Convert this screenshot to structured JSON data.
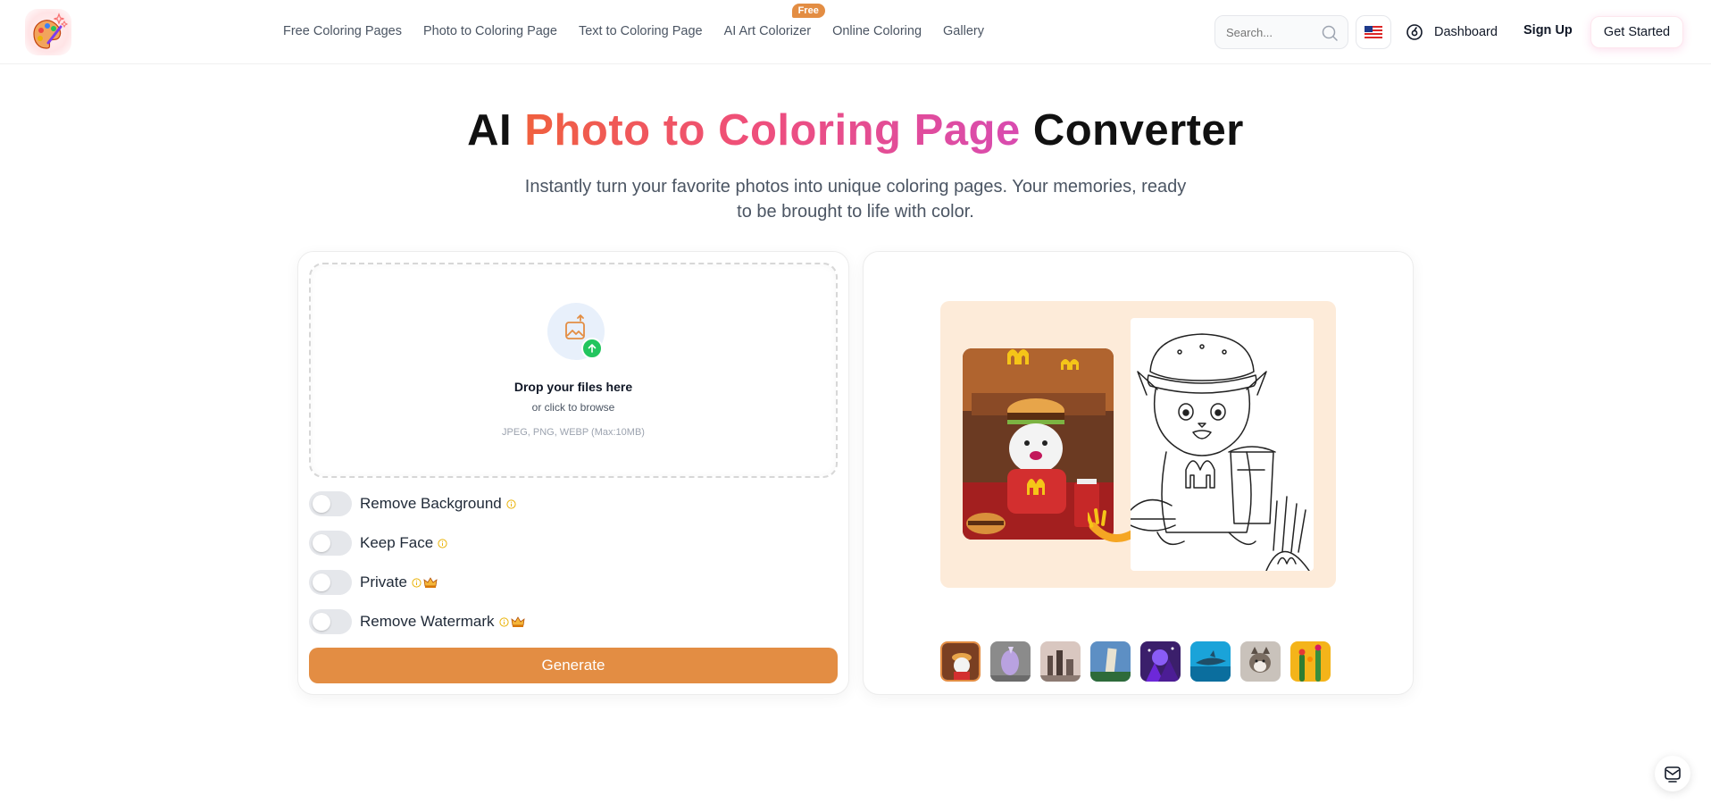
{
  "nav": {
    "items": [
      {
        "label": "Free Coloring Pages"
      },
      {
        "label": "Photo to Coloring Page"
      },
      {
        "label": "Text to Coloring Page"
      },
      {
        "label": "AI Art Colorizer",
        "badge": "Free"
      },
      {
        "label": "Online Coloring"
      },
      {
        "label": "Gallery"
      }
    ],
    "search_placeholder": "Search...",
    "dashboard": "Dashboard",
    "sign_up": "Sign Up",
    "get_started": "Get Started"
  },
  "hero": {
    "title_prefix": "AI",
    "title_highlight": "Photo to Coloring Page",
    "title_suffix": "Converter",
    "subtitle": "Instantly turn your favorite photos into unique coloring pages. Your memories, ready to be brought to life with color."
  },
  "upload": {
    "title": "Drop your files here",
    "subtitle": "or click to browse",
    "formats": "JPEG, PNG, WEBP (Max:10MB)"
  },
  "options": [
    {
      "label": "Remove Background",
      "enabled": false,
      "premium": false
    },
    {
      "label": "Keep Face",
      "enabled": false,
      "premium": false
    },
    {
      "label": "Private",
      "enabled": false,
      "premium": true
    },
    {
      "label": "Remove Watermark",
      "enabled": false,
      "premium": true
    }
  ],
  "generate_label": "Generate",
  "colors": {
    "accent": "#e38d43",
    "title_gradient": [
      "#f0603e",
      "#ef4f7a",
      "#d84bb0"
    ],
    "upload_badge": "#22c55e",
    "preview_bg": "#fdebd9"
  },
  "examples": {
    "selected_index": 0,
    "thumbnails": [
      "burger-cat",
      "lavender-unicorn",
      "city-skyline",
      "pisa-tower",
      "purple-fantasy",
      "blue-shark",
      "husky-dog",
      "cactus-flowers"
    ]
  }
}
